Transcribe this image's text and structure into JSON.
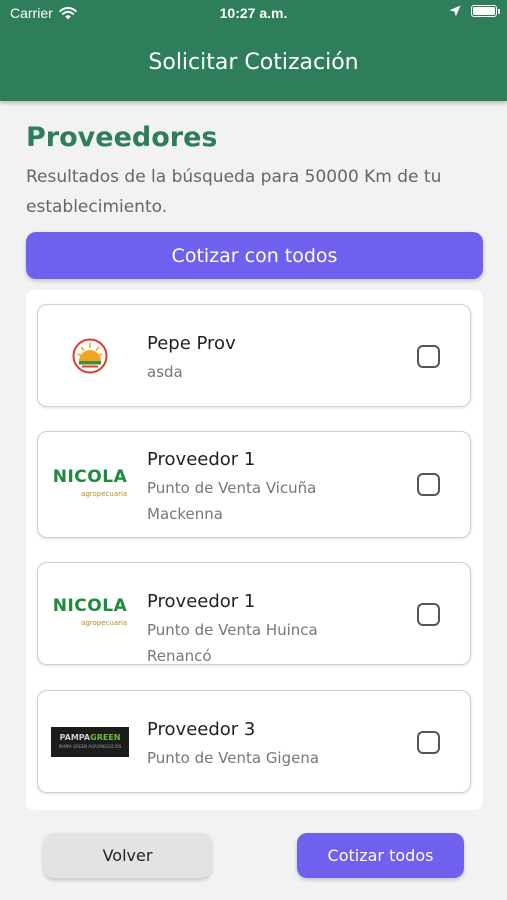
{
  "status_bar": {
    "carrier": "Carrier",
    "time": "10:27 a.m."
  },
  "header": {
    "title": "Solicitar Cotización"
  },
  "section": {
    "title": "Proveedores",
    "description": "Resultados de la búsqueda para 50000 Km de tu establecimiento."
  },
  "quote_all_button": "Cotizar con todos",
  "providers": [
    {
      "name": "Pepe Prov",
      "subtitle": "asda",
      "logo": "sun-logo-icon"
    },
    {
      "name": "Proveedor 1",
      "subtitle": "Punto de Venta Vicuña Mackenna",
      "logo": "nicola-logo",
      "logo_text": "NICOLA",
      "logo_sub": "agropecuaria"
    },
    {
      "name": "Proveedor 1",
      "subtitle": "Punto de Venta Huinca Renancó",
      "logo": "nicola-logo",
      "logo_text": "NICOLA",
      "logo_sub": "agropecuaria"
    },
    {
      "name": "Proveedor 3",
      "subtitle": "Punto de Venta Gigena",
      "logo": "pampa-logo"
    }
  ],
  "footer": {
    "back_label": "Volver",
    "quote_label": "Cotizar todos"
  },
  "colors": {
    "primary_green": "#2e7d5b",
    "accent_purple": "#7060ee",
    "nicola_green": "#1e8a3c"
  }
}
